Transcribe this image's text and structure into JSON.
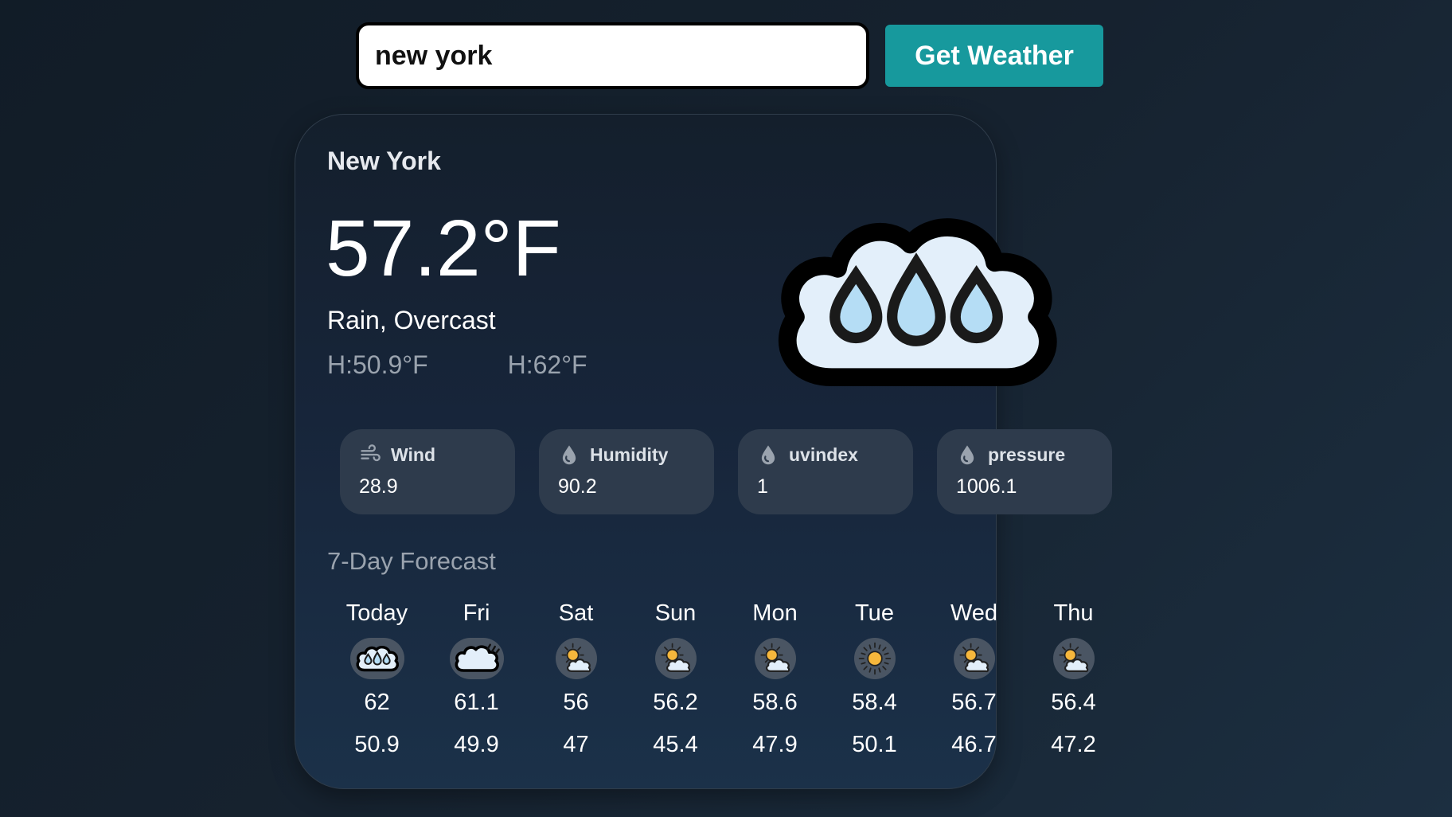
{
  "search": {
    "value": "new york",
    "button_label": "Get Weather"
  },
  "current": {
    "city": "New York",
    "temperature": "57.2°F",
    "condition": "Rain, Overcast",
    "low": "H:50.9°F",
    "high": "H:62°F",
    "icon": "rain-cloud-icon"
  },
  "stats": [
    {
      "label": "Wind",
      "value": "28.9",
      "icon": "wind-icon"
    },
    {
      "label": "Humidity",
      "value": "90.2",
      "icon": "droplet-icon"
    },
    {
      "label": "uvindex",
      "value": "1",
      "icon": "droplet-icon"
    },
    {
      "label": "pressure",
      "value": "1006.1",
      "icon": "droplet-icon"
    }
  ],
  "forecast_title": "7-Day Forecast",
  "forecast": [
    {
      "day": "Today",
      "high": "62",
      "low": "50.9",
      "icon": "rain-cloud-icon"
    },
    {
      "day": "Fri",
      "high": "61.1",
      "low": "49.9",
      "icon": "cloud-drizzle-icon"
    },
    {
      "day": "Sat",
      "high": "56",
      "low": "47",
      "icon": "partly-cloudy-icon"
    },
    {
      "day": "Sun",
      "high": "56.2",
      "low": "45.4",
      "icon": "partly-cloudy-icon"
    },
    {
      "day": "Mon",
      "high": "58.6",
      "low": "47.9",
      "icon": "partly-cloudy-icon"
    },
    {
      "day": "Tue",
      "high": "58.4",
      "low": "50.1",
      "icon": "sun-icon"
    },
    {
      "day": "Wed",
      "high": "56.7",
      "low": "46.7",
      "icon": "partly-cloudy-icon"
    },
    {
      "day": "Thu",
      "high": "56.4",
      "low": "47.2",
      "icon": "partly-cloudy-icon"
    }
  ],
  "colors": {
    "accent": "#17999d",
    "card_bg": "#17253a",
    "stat_bg": "#2e3b4c",
    "muted_text": "#9aa3ae"
  }
}
